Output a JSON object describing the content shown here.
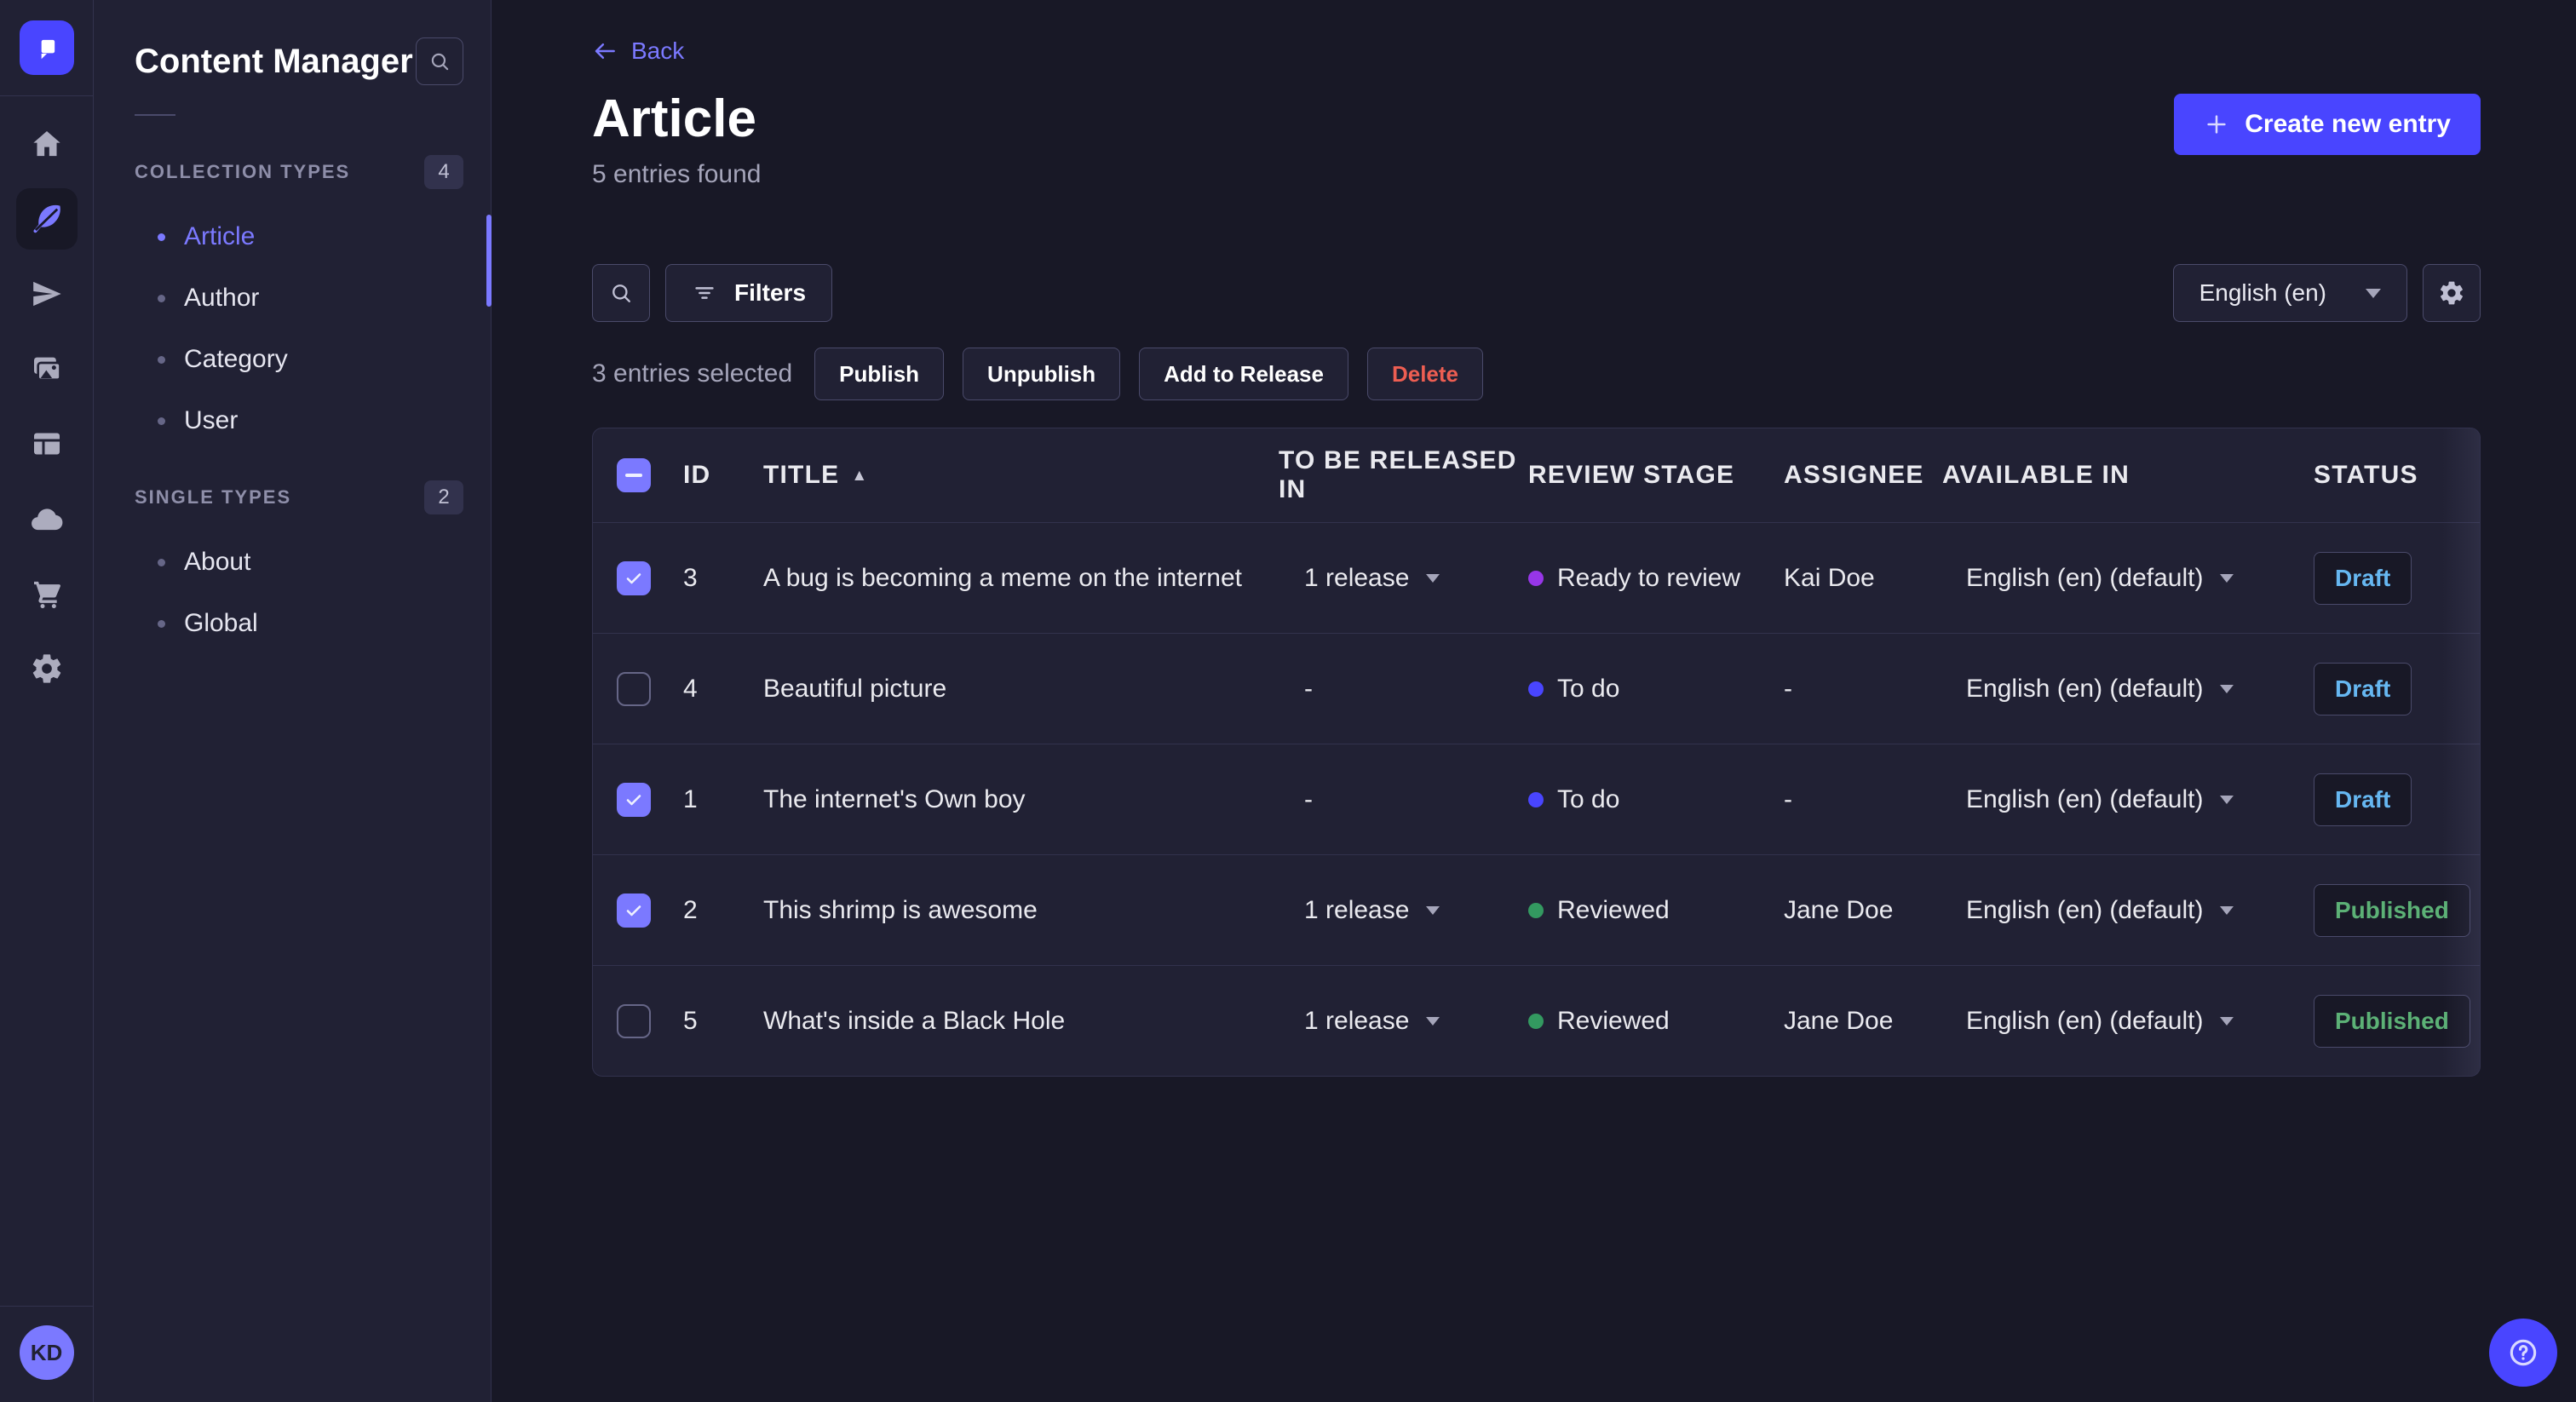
{
  "app": {
    "brand_color": "#4945ff"
  },
  "rail": {
    "icons": [
      {
        "name": "home"
      },
      {
        "name": "feather",
        "active": true
      },
      {
        "name": "send"
      },
      {
        "name": "images"
      },
      {
        "name": "layout"
      },
      {
        "name": "cloud"
      },
      {
        "name": "cart"
      },
      {
        "name": "gear"
      }
    ],
    "avatar_initials": "KD"
  },
  "sidebar": {
    "title": "Content Manager",
    "sections": [
      {
        "label": "COLLECTION TYPES",
        "count": "4",
        "items": [
          {
            "label": "Article",
            "active": true
          },
          {
            "label": "Author"
          },
          {
            "label": "Category"
          },
          {
            "label": "User"
          }
        ]
      },
      {
        "label": "SINGLE TYPES",
        "count": "2",
        "items": [
          {
            "label": "About"
          },
          {
            "label": "Global"
          }
        ]
      }
    ]
  },
  "header": {
    "back_label": "Back",
    "title": "Article",
    "subtitle": "5 entries found",
    "create_label": "Create new entry"
  },
  "toolbar": {
    "filters_label": "Filters",
    "locale_value": "English (en)"
  },
  "selection": {
    "text": "3 entries selected",
    "actions": [
      {
        "label": "Publish"
      },
      {
        "label": "Unpublish"
      },
      {
        "label": "Add to Release"
      },
      {
        "label": "Delete",
        "danger": true
      }
    ]
  },
  "table": {
    "columns": [
      "ID",
      "TITLE",
      "TO BE RELEASED IN",
      "REVIEW STAGE",
      "ASSIGNEE",
      "AVAILABLE IN",
      "STATUS"
    ],
    "sorted_column": "TITLE",
    "sort_direction": "asc",
    "rows": [
      {
        "checked": true,
        "id": "3",
        "title": "A bug is becoming a meme on the internet",
        "release": "1 release",
        "review_stage": "Ready to review",
        "dot_style": "background:#9736e8",
        "assignee": "Kai Doe",
        "locale": "English (en) (default)",
        "status": "Draft",
        "status_style": "color:#66b7f1"
      },
      {
        "checked": false,
        "id": "4",
        "title": "Beautiful picture",
        "release": "-",
        "review_stage": "To do",
        "dot_style": "background:#4945ff",
        "assignee": "-",
        "locale": "English (en) (default)",
        "status": "Draft",
        "status_style": "color:#66b7f1"
      },
      {
        "checked": true,
        "id": "1",
        "title": "The internet's Own boy",
        "release": "-",
        "review_stage": "To do",
        "dot_style": "background:#4945ff",
        "assignee": "-",
        "locale": "English (en) (default)",
        "status": "Draft",
        "status_style": "color:#66b7f1"
      },
      {
        "checked": true,
        "id": "2",
        "title": "This shrimp is awesome",
        "release": "1 release",
        "review_stage": "Reviewed",
        "dot_style": "background:#339960",
        "assignee": "Jane Doe",
        "locale": "English (en) (default)",
        "status": "Published",
        "status_style": "color:#5cb176"
      },
      {
        "checked": false,
        "id": "5",
        "title": "What's inside a Black Hole",
        "release": "1 release",
        "review_stage": "Reviewed",
        "dot_style": "background:#339960",
        "assignee": "Jane Doe",
        "locale": "English (en) (default)",
        "status": "Published",
        "status_style": "color:#5cb176"
      }
    ]
  },
  "colors": {
    "primary": "#4945ff",
    "primary_light": "#7b79ff",
    "draft_text": "#66b7f1",
    "published_text": "#5cb176",
    "danger_text": "#ee5e52",
    "stage_ready_to_review": "#9736e8",
    "stage_to_do": "#4945ff",
    "stage_reviewed": "#339960"
  }
}
